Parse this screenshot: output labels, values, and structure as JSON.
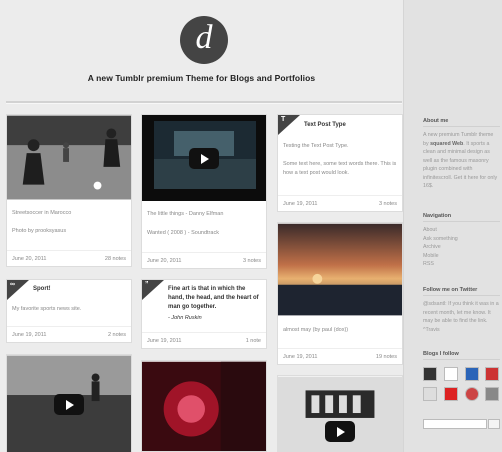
{
  "header": {
    "logo_letter": "d",
    "tagline": "A new Tumblr premium Theme for Blogs and Portfolios"
  },
  "posts": [
    {
      "caption": "Streetsoccer in Marocco",
      "photo_by": "Photo by prooksyasus",
      "date": "June 20, 2011",
      "notes": "28 notes"
    },
    {
      "caption": "The little things - Danny Elfman",
      "sub": "Wanted ( 2008 ) - Soundtrack",
      "date": "June 20, 2011",
      "notes": "3 notes"
    },
    {
      "badge": "T",
      "title": "Text Post Type",
      "line1": "Testing the Text Post Type.",
      "line2": "Some text here, some text words there. This is how a text post would look.",
      "date": "June 19, 2011",
      "notes": "3 notes"
    },
    {
      "badge": "∞",
      "title": "Sport!",
      "body": "My favorite sports news site.",
      "date": "June 19, 2011",
      "notes": "2 notes"
    },
    {
      "badge": "”",
      "quote": "Fine art is that in which the hand, the head, and the heart of man go together.",
      "source": "- John Ruskin",
      "date": "June 19, 2011",
      "notes": "1 note"
    },
    {
      "caption": "almost may (by paul (dox))",
      "date": "June 19, 2011",
      "notes": "19 notes"
    }
  ],
  "sidebar": {
    "about_title": "About me",
    "about_text_pre": "A new premium Tumblr theme by ",
    "about_author": "squared Web",
    "about_text_post": ". It sports a clean and minimal design as well as the famous masonry plugin combined with infinitescroll. Get it here for only 16$.",
    "nav_title": "Navigation",
    "nav_items": [
      "About",
      "Ask something",
      "Archive",
      "Mobile",
      "RSS"
    ],
    "twitter_title": "Follow me on Twitter",
    "twitter_text": "@sdsantl: If you think it was in a recent month, let me know. It may be able to find the link. ^Travis",
    "blogs_title": "Blogs I follow"
  },
  "colors": {
    "accent": "#444444",
    "background": "#ececec",
    "sidebar": "#e2e2e2"
  }
}
